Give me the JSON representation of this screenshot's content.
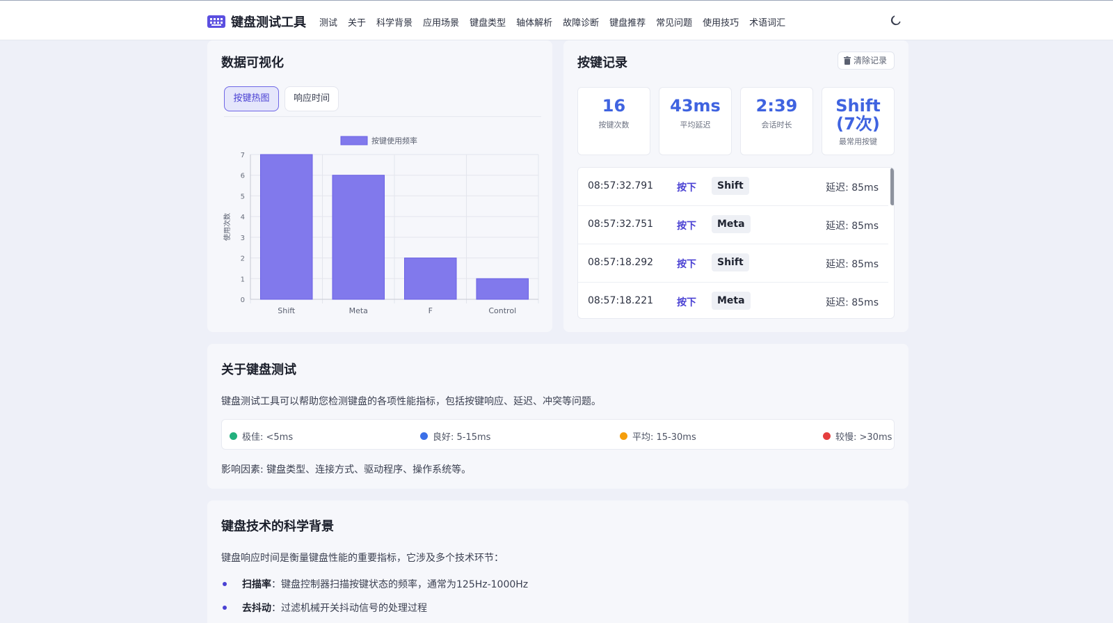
{
  "header": {
    "brand": "键盘测试工具",
    "nav": [
      "测试",
      "关于",
      "科学背景",
      "应用场景",
      "键盘类型",
      "轴体解析",
      "故障诊断",
      "键盘推荐",
      "常见问题",
      "使用技巧",
      "术语词汇"
    ],
    "theme_icon": "moon-icon"
  },
  "viz": {
    "title": "数据可视化",
    "tabs": [
      "按键热图",
      "响应时间"
    ],
    "active_tab": "按键热图"
  },
  "chart_data": {
    "type": "bar",
    "categories": [
      "Shift",
      "Meta",
      "F",
      "Control"
    ],
    "series": [
      {
        "name": "按键使用频率",
        "values": [
          7,
          6,
          2,
          1
        ],
        "color": "#8179ec"
      }
    ],
    "ylabel": "使用次数",
    "xlabel": "",
    "ylim": [
      0,
      7
    ],
    "yticks": [
      0,
      1,
      2,
      3,
      4,
      5,
      6,
      7
    ],
    "grid": true,
    "legend": "top-center"
  },
  "log": {
    "title": "按键记录",
    "clear_label": "清除记录",
    "stats": [
      {
        "value": "16",
        "label": "按键次数"
      },
      {
        "value": "43ms",
        "label": "平均延迟"
      },
      {
        "value": "2:39",
        "label": "会话时长"
      },
      {
        "value": "Shift\n(7次)",
        "label": "最常用按键"
      }
    ],
    "rows": [
      {
        "time": "08:57:32.791",
        "action": "按下",
        "key": "Shift",
        "delay": "延迟: 85ms"
      },
      {
        "time": "08:57:32.751",
        "action": "按下",
        "key": "Meta",
        "delay": "延迟: 85ms"
      },
      {
        "time": "08:57:18.292",
        "action": "按下",
        "key": "Shift",
        "delay": "延迟: 85ms"
      },
      {
        "time": "08:57:18.221",
        "action": "按下",
        "key": "Meta",
        "delay": "延迟: 85ms"
      }
    ]
  },
  "about": {
    "title": "关于键盘测试",
    "desc": "键盘测试工具可以帮助您检测键盘的各项性能指标，包括按键响应、延迟、冲突等问题。",
    "levels": [
      {
        "label": "极佳: <5ms",
        "color": "#22b07d"
      },
      {
        "label": "良好: 5-15ms",
        "color": "#3b6fe8"
      },
      {
        "label": "平均: 15-30ms",
        "color": "#f59e0b"
      },
      {
        "label": "较慢: >30ms",
        "color": "#e53e3e"
      }
    ],
    "factors": "影响因素: 键盘类型、连接方式、驱动程序、操作系统等。"
  },
  "science": {
    "title": "键盘技术的科学背景",
    "intro": "键盘响应时间是衡量键盘性能的重要指标，它涉及多个技术环节：",
    "items": [
      {
        "term": "扫描率",
        "text": "：键盘控制器扫描按键状态的频率，通常为125Hz-1000Hz"
      },
      {
        "term": "去抖动",
        "text": "：过滤机械开关抖动信号的处理过程"
      }
    ]
  }
}
